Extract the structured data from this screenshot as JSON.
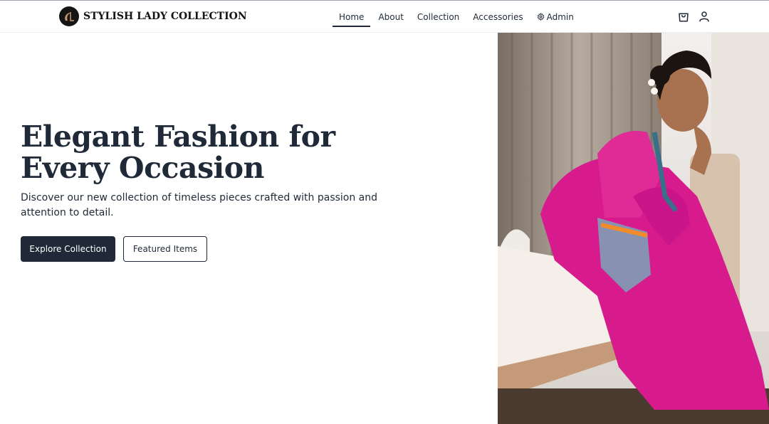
{
  "brand": {
    "logo_text": "SL",
    "name": "STYLISH LADY COLLECTION"
  },
  "nav": {
    "items": [
      {
        "label": "Home",
        "active": true
      },
      {
        "label": "About"
      },
      {
        "label": "Collection"
      },
      {
        "label": "Accessories"
      },
      {
        "label": "Admin",
        "icon": "gear-icon"
      }
    ]
  },
  "header_actions": {
    "cart_icon": "shopping-bag-icon",
    "user_icon": "user-icon"
  },
  "hero": {
    "title": "Elegant Fashion for Every Occasion",
    "subtitle": "Discover our new collection of timeless pieces crafted with passion and attention to detail.",
    "primary_button": "Explore Collection",
    "secondary_button": "Featured Items"
  },
  "colors": {
    "primary": "#1f2937",
    "background": "#ffffff",
    "saree_pink": "#d81b8c"
  }
}
